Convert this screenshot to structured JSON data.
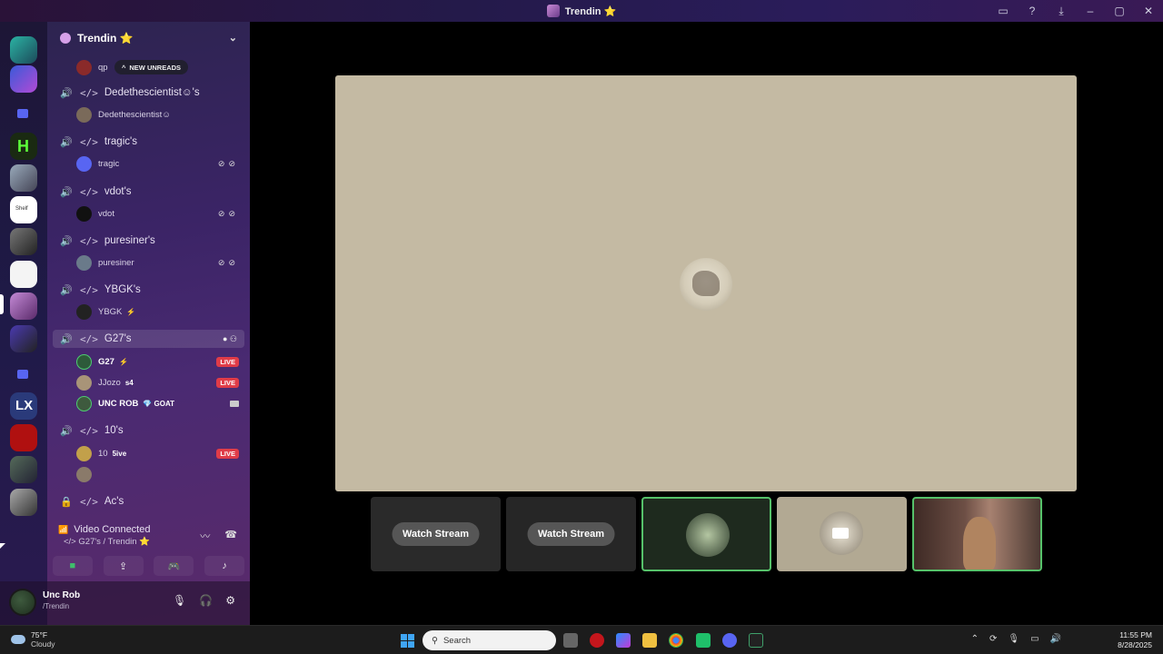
{
  "window": {
    "title": "Trendin ⭐",
    "buttons": [
      "inbox",
      "help",
      "download"
    ]
  },
  "server": {
    "name": "Trendin ⭐",
    "new_unreads_label": "NEW UNREADS",
    "first_user_partial": "qp"
  },
  "channels": [
    {
      "name": "Dedethescientist☺'s",
      "users": [
        {
          "name": "Dedethescientist☺",
          "badge": "",
          "live": false,
          "muted": false
        }
      ]
    },
    {
      "name": "tragic's",
      "users": [
        {
          "name": "tragic",
          "badge": "",
          "live": false,
          "muted": true
        }
      ]
    },
    {
      "name": "vdot's",
      "users": [
        {
          "name": "vdot",
          "badge": "",
          "live": false,
          "muted": true
        }
      ]
    },
    {
      "name": "puresiner's",
      "users": [
        {
          "name": "puresiner",
          "badge": "",
          "live": false,
          "muted": true
        }
      ]
    },
    {
      "name": "YBGK's",
      "users": [
        {
          "name": "YBGK",
          "badge": "⚡",
          "live": false,
          "muted": false
        }
      ]
    },
    {
      "name": "G27's",
      "selected": true,
      "users": [
        {
          "name": "G27",
          "badge": "⚡",
          "live": true
        },
        {
          "name": "JJozo",
          "badge": "s4",
          "live": true
        },
        {
          "name": "UNC ROB",
          "badge": "💎 GOAT",
          "live": false,
          "camera": true
        }
      ]
    },
    {
      "name": "10's",
      "users": [
        {
          "name": "10",
          "badge": "5ive",
          "live": true
        },
        {
          "name": "",
          "badge": "",
          "live": false
        }
      ]
    },
    {
      "name": "Ac's",
      "locked": true,
      "users": []
    }
  ],
  "live_label": "LIVE",
  "voice": {
    "status": "Video Connected",
    "location": "G27's / Trendin ⭐"
  },
  "user": {
    "name": "Unc Rob",
    "status": "/Trendin"
  },
  "stage": {
    "tiles": [
      {
        "type": "stream",
        "label": "Watch Stream"
      },
      {
        "type": "stream",
        "label": "Watch Stream"
      },
      {
        "type": "avatar",
        "selected": true
      },
      {
        "type": "camera-off"
      },
      {
        "type": "camera",
        "selected": true
      }
    ]
  },
  "taskbar": {
    "weather_temp": "75°F",
    "weather_desc": "Cloudy",
    "search_placeholder": "Search",
    "time": "11:55 PM",
    "date": "8/28/2025"
  },
  "colors": {
    "accent": "#5865f2",
    "live": "#e03c48",
    "connected": "#4ecb71",
    "stage_bg": "#c4baa3"
  }
}
